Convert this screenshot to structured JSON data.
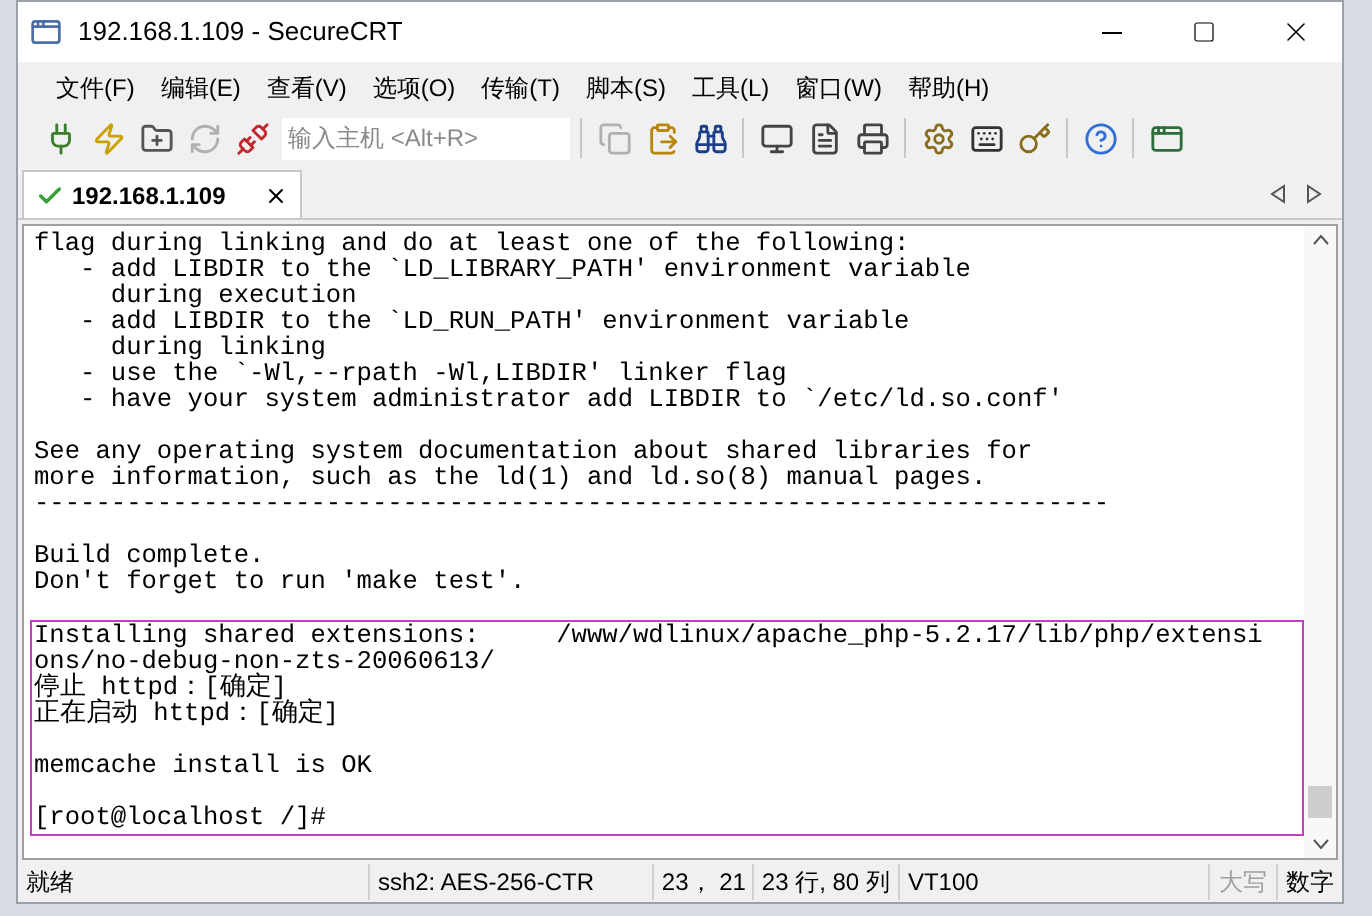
{
  "window": {
    "title": "192.168.1.109 - SecureCRT"
  },
  "menu": [
    "文件(F)",
    "编辑(E)",
    "查看(V)",
    "选项(O)",
    "传输(T)",
    "脚本(S)",
    "工具(L)",
    "窗口(W)",
    "帮助(H)"
  ],
  "toolbar": {
    "groups": [
      [
        {
          "kind": "connect",
          "disabled": false
        },
        {
          "kind": "quick",
          "disabled": false
        },
        {
          "kind": "tab",
          "disabled": false
        },
        {
          "kind": "reconnect",
          "disabled": true
        },
        {
          "kind": "disconnect",
          "disabled": false
        }
      ],
      [
        {
          "kind": "copy",
          "disabled": true
        },
        {
          "kind": "paste",
          "disabled": false
        },
        {
          "kind": "find",
          "disabled": false
        }
      ],
      [
        {
          "kind": "printsel",
          "disabled": false
        },
        {
          "kind": "printscreen",
          "disabled": false
        },
        {
          "kind": "print",
          "disabled": false
        }
      ],
      [
        {
          "kind": "options",
          "disabled": false
        },
        {
          "kind": "keymap",
          "disabled": false
        },
        {
          "kind": "key",
          "disabled": false
        }
      ],
      [
        {
          "kind": "help",
          "disabled": false
        }
      ],
      [
        {
          "kind": "session",
          "disabled": false
        }
      ]
    ],
    "host_field": {
      "placeholder": "输入主机 <Alt+R>"
    }
  },
  "tabs": [
    {
      "label": "192.168.1.109",
      "selected": true,
      "connected": true
    }
  ],
  "terminal": {
    "blocks": [
      [
        "flag during linking and do at least one of the following:",
        "   - add LIBDIR to the `LD_LIBRARY_PATH' environment variable",
        "     during execution",
        "   - add LIBDIR to the `LD_RUN_PATH' environment variable",
        "     during linking",
        "   - use the `-Wl,--rpath -Wl,LIBDIR' linker flag",
        "   - have your system administrator add LIBDIR to `/etc/ld.so.conf'"
      ],
      [
        "See any operating system documentation about shared libraries for",
        "more information, such as the ld(1) and ld.so(8) manual pages.",
        "----------------------------------------------------------------------"
      ],
      [
        "Build complete.",
        "Don't forget to run 'make test'."
      ]
    ],
    "highlighted_blocks": [
      [
        "Installing shared extensions:     /www/wdlinux/apache_php-5.2.17/lib/php/extensi",
        "ons/no-debug-non-zts-20060613/",
        "停止 httpd：[确定]",
        "正在启动 httpd：[确定]"
      ],
      [
        "memcache install is OK"
      ],
      [
        "[root@localhost /]#"
      ]
    ]
  },
  "status_bar": [
    {
      "text": "就绪",
      "disabled": false
    },
    {
      "text": "ssh2: AES-256-CTR",
      "disabled": false
    },
    {
      "text": "23，  21",
      "disabled": false
    },
    {
      "text": "23 行, 80 列",
      "disabled": false
    },
    {
      "text": "VT100",
      "disabled": false
    },
    {
      "text": "大写",
      "disabled": true
    },
    {
      "text": "数字",
      "disabled": false
    }
  ]
}
